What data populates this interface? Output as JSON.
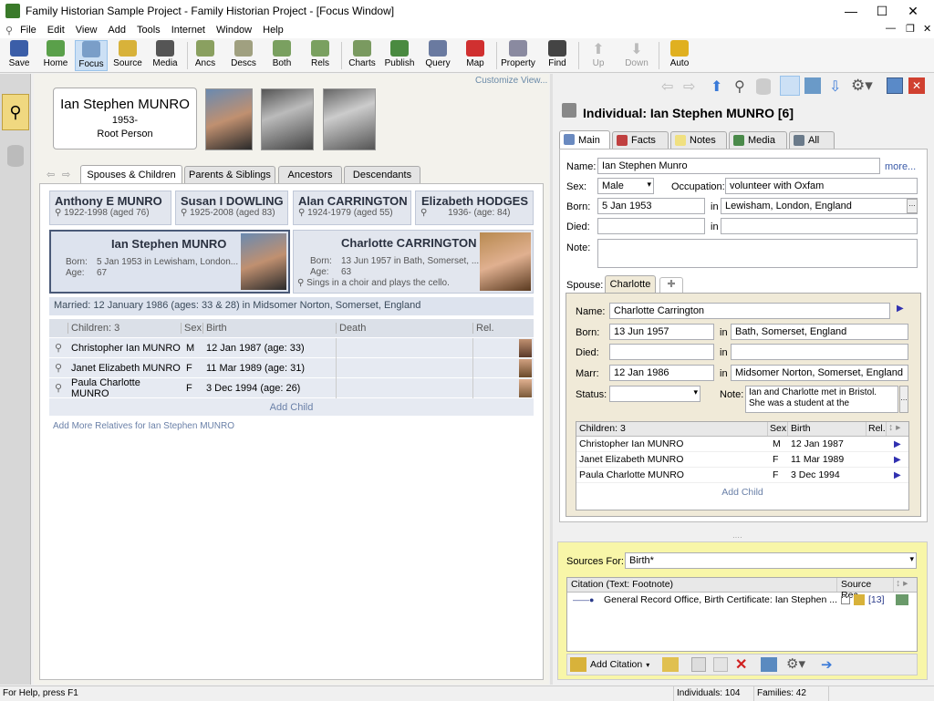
{
  "window": {
    "title": "Family Historian Sample Project - Family Historian Project - [Focus Window]"
  },
  "menu": [
    "File",
    "Edit",
    "View",
    "Add",
    "Tools",
    "Internet",
    "Window",
    "Help"
  ],
  "toolbar": {
    "save": "Save",
    "home": "Home",
    "focus": "Focus",
    "source": "Source",
    "media": "Media",
    "ancs": "Ancs",
    "descs": "Descs",
    "both": "Both",
    "rels": "Rels",
    "charts": "Charts",
    "publish": "Publish",
    "query": "Query",
    "map": "Map",
    "property": "Property",
    "find": "Find",
    "up": "Up",
    "down": "Down",
    "auto": "Auto"
  },
  "focus": {
    "customize": "Customize View...",
    "root": {
      "name": "Ian Stephen MUNRO",
      "years": "1953-",
      "role": "Root Person"
    },
    "tabs": [
      "Spouses & Children",
      "Parents & Siblings",
      "Ancestors",
      "Descendants"
    ],
    "parents": [
      {
        "name": "Anthony E MUNRO",
        "dates": "1922-1998 (aged 76)"
      },
      {
        "name": "Susan I DOWLING",
        "dates": "1925-2008 (aged 83)"
      },
      {
        "name": "Alan CARRINGTON",
        "dates": "1924-1979 (aged 55)"
      },
      {
        "name": "Elizabeth HODGES",
        "dates": "1936-  (age: 84)"
      }
    ],
    "main_person": {
      "name": "Ian Stephen MUNRO",
      "born_label": "Born:",
      "born": "5 Jan 1953 in Lewisham, London...",
      "age_label": "Age:",
      "age": "67"
    },
    "spouse": {
      "name": "Charlotte CARRINGTON",
      "born_label": "Born:",
      "born": "13 Jun 1957 in Bath, Somerset, ...",
      "age_label": "Age:",
      "age": "63",
      "note": "Sings in a choir and plays the cello."
    },
    "married": "Married: 12 January 1986 (ages: 33 & 28) in Midsomer Norton, Somerset, England",
    "children_header": {
      "children": "Children: 3",
      "sex": "Sex",
      "birth": "Birth",
      "death": "Death",
      "rel": "Rel."
    },
    "children": [
      {
        "name": "Christopher Ian MUNRO",
        "sex": "M",
        "birth": "12 Jan 1987 (age: 33)"
      },
      {
        "name": "Janet Elizabeth MUNRO",
        "sex": "F",
        "birth": "11 Mar 1989 (age: 31)"
      },
      {
        "name": "Paula Charlotte MUNRO",
        "sex": "F",
        "birth": "3 Dec 1994 (age: 26)"
      }
    ],
    "add_child": "Add Child",
    "add_more": "Add More Relatives for Ian Stephen MUNRO"
  },
  "record": {
    "title": "Individual: Ian Stephen MUNRO [6]",
    "tabs": [
      "Main",
      "Facts",
      "Notes",
      "Media",
      "All"
    ],
    "name_label": "Name:",
    "name": "Ian Stephen Munro",
    "more": "more...",
    "sex_label": "Sex:",
    "sex": "Male",
    "occ_label": "Occupation:",
    "occupation": "volunteer with Oxfam",
    "born_label": "Born:",
    "born_date": "5 Jan 1953",
    "in": "in",
    "born_place": "Lewisham, London, England",
    "died_label": "Died:",
    "note_label": "Note:",
    "spouse_label": "Spouse:",
    "spouse_tab": "Charlotte",
    "sp": {
      "name_label": "Name:",
      "name": "Charlotte Carrington",
      "born_label": "Born:",
      "born_date": "13 Jun 1957",
      "born_place": "Bath, Somerset, England",
      "died_label": "Died:",
      "marr_label": "Marr:",
      "marr_date": "12 Jan 1986",
      "marr_place": "Midsomer Norton, Somerset, England",
      "status_label": "Status:",
      "note_label": "Note:",
      "note": "Ian and Charlotte met in Bristol. She was a student at the"
    },
    "children_header": {
      "children": "Children: 3",
      "sex": "Sex",
      "birth": "Birth",
      "rel": "Rel."
    },
    "children": [
      {
        "name": "Christopher Ian MUNRO",
        "sex": "M",
        "birth": "12 Jan 1987"
      },
      {
        "name": "Janet Elizabeth MUNRO",
        "sex": "F",
        "birth": "11 Mar 1989"
      },
      {
        "name": "Paula Charlotte MUNRO",
        "sex": "F",
        "birth": "3 Dec 1994"
      }
    ],
    "add_child": "Add Child"
  },
  "sources": {
    "label": "Sources For:",
    "value": "Birth*",
    "col_citation": "Citation (Text: Footnote)",
    "col_source": "Source Rec",
    "citation": "General Record Office, Birth Certificate: Ian Stephen ...",
    "source_rec": "[13]",
    "add_citation": "Add Citation"
  },
  "status": {
    "help": "For Help, press F1",
    "individuals": "Individuals: 104",
    "families": "Families: 42"
  }
}
